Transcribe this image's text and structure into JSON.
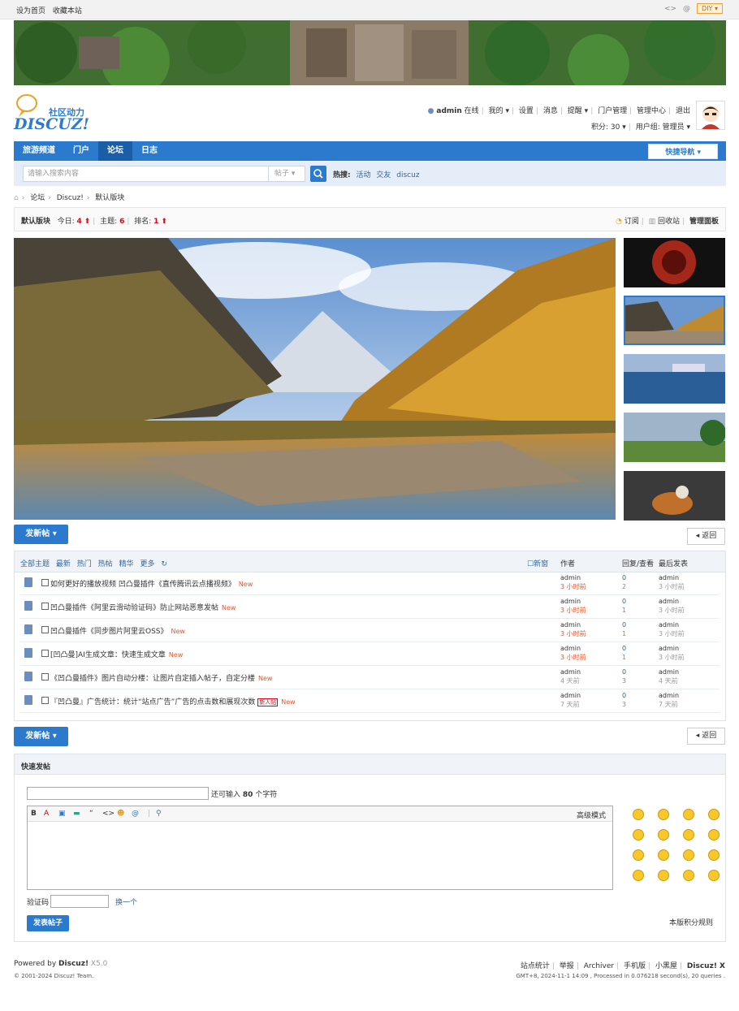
{
  "topbar": {
    "set_home": "设为首页",
    "bookmark": "收藏本站",
    "diy": "DIY"
  },
  "logo": {
    "cn": "社区动力",
    "en": "DISCUZ!"
  },
  "user": {
    "name": "admin",
    "status": "在线",
    "mine": "我的",
    "settings": "设置",
    "messages": "消息",
    "remind": "提醒",
    "portal_admin": "门户管理",
    "admin_center": "管理中心",
    "logout": "退出",
    "credits": "积分: 30",
    "group": "用户组: 管理员"
  },
  "nav": {
    "items": [
      "旅游频道",
      "门户",
      "论坛",
      "日志"
    ],
    "active": "论坛",
    "quick": "快捷导航"
  },
  "search": {
    "placeholder": "请输入搜索内容",
    "type": "帖子",
    "hot_label": "热搜:",
    "hot": [
      "活动",
      "交友",
      "discuz"
    ]
  },
  "breadcrumb": [
    "论坛",
    "Discuz!",
    "默认版块"
  ],
  "forum": {
    "name": "默认版块",
    "today_label": "今日:",
    "today": "4",
    "topics_label": "主题:",
    "topics": "6",
    "rank_label": "排名:",
    "rank": "1",
    "subscribe": "订阅",
    "recycle": "回收站",
    "manage": "管理面板"
  },
  "buttons": {
    "post": "发新帖",
    "back": "返回"
  },
  "thread_header": {
    "tabs": [
      "全部主题",
      "最新",
      "热门",
      "热帖",
      "精华",
      "更多"
    ],
    "new_window": "新窗",
    "author": "作者",
    "replies": "回复/查看",
    "last_post": "最后发表"
  },
  "threads": [
    {
      "title": "如何更好的播放视频 凹凸曼插件《直传腾讯云点播视频》",
      "tag": "",
      "new": "New",
      "author": "admin",
      "time": "3 小时前",
      "replies": "0",
      "views": "2",
      "last_user": "admin",
      "last_time": "3 小时前"
    },
    {
      "title": "凹凸曼插件《阿里云滑动验证码》防止网站恶意发帖",
      "tag": "",
      "new": "New",
      "author": "admin",
      "time": "3 小时前",
      "replies": "0",
      "views": "1",
      "last_user": "admin",
      "last_time": "3 小时前"
    },
    {
      "title": "凹凸曼插件《同步图片阿里云OSS》",
      "tag": "",
      "new": "New",
      "author": "admin",
      "time": "3 小时前",
      "replies": "0",
      "views": "1",
      "last_user": "admin",
      "last_time": "3 小时前"
    },
    {
      "title": "[凹凸曼]AI生成文章：快速生成文章",
      "tag": "",
      "new": "New",
      "author": "admin",
      "time": "3 小时前",
      "replies": "0",
      "views": "1",
      "last_user": "admin",
      "last_time": "3 小时前"
    },
    {
      "title": "《凹凸曼插件》图片自动分楼：让图片自定插入帖子，自定分楼",
      "tag": "",
      "new": "New",
      "author": "admin",
      "time": "4 天前",
      "replies": "0",
      "views": "3",
      "last_user": "admin",
      "last_time": "4 天前"
    },
    {
      "title": "『凹凸曼』广告统计：统计“站点广告”广告的点击数和展现次数",
      "tag": "新人帖",
      "new": "New",
      "author": "admin",
      "time": "7 天前",
      "replies": "0",
      "views": "3",
      "last_user": "admin",
      "last_time": "7 天前"
    }
  ],
  "quick_post": {
    "title": "快速发帖",
    "remain_pre": "还可输入",
    "remain_num": "80",
    "remain_post": "个字符",
    "advanced": "高级模式",
    "captcha": "验证码",
    "change": "换一个",
    "submit": "发表帖子",
    "rules": "本版积分规则"
  },
  "footer": {
    "powered": "Powered by",
    "brand": "Discuz!",
    "version": "X5.0",
    "copy": "© 2001-2024 Discuz! Team.",
    "links": [
      "站点统计",
      "举报",
      "Archiver",
      "手机版",
      "小黑屋"
    ],
    "brand2": "Discuz! X",
    "debug": "GMT+8, 2024-11-1 14:09 , Processed in 0.076218 second(s), 20 queries ."
  }
}
